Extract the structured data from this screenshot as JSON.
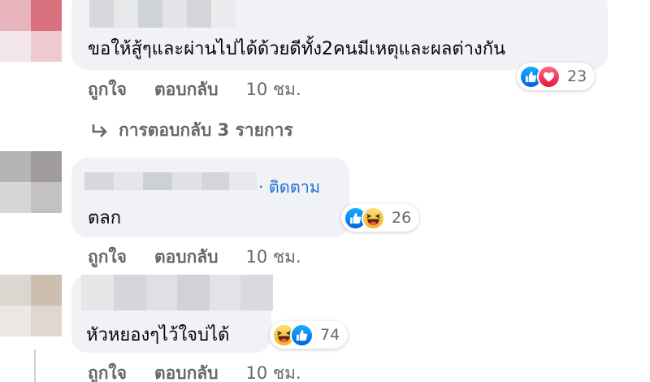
{
  "comments": [
    {
      "text": "ขอให้สู้ๆและผ่านไปได้ด้วยดีทั้ง2คนมีเหตุและผลต่างกัน",
      "reaction_count": "23",
      "reaction_icons": [
        "like-icon",
        "love-icon"
      ],
      "actions": {
        "like": "ถูกใจ",
        "reply": "ตอบกลับ",
        "time": "10 ชม."
      },
      "replies_link": "การตอบกลับ 3 รายการ"
    },
    {
      "follow_label": "· ติดตาม",
      "text": "ตลก",
      "reaction_count": "26",
      "reaction_icons": [
        "like-icon",
        "haha-icon"
      ],
      "actions": {
        "like": "ถูกใจ",
        "reply": "ตอบกลับ",
        "time": "10 ชม."
      }
    },
    {
      "text": "หัวหยองๆไว้ใจบ่ได้",
      "reaction_count": "74",
      "reaction_icons": [
        "haha-icon",
        "like-icon"
      ],
      "actions": {
        "like": "ถูกใจ",
        "reply": "ตอบกลับ",
        "time": "10 ชม."
      }
    }
  ],
  "colors": {
    "bubble": "#f0f2f5",
    "secondary_text": "#65676b",
    "link_blue": "#216fdb",
    "like_blue": "#1877f2",
    "love_red": "#f33e58",
    "haha_yellow": "#f7b125"
  }
}
